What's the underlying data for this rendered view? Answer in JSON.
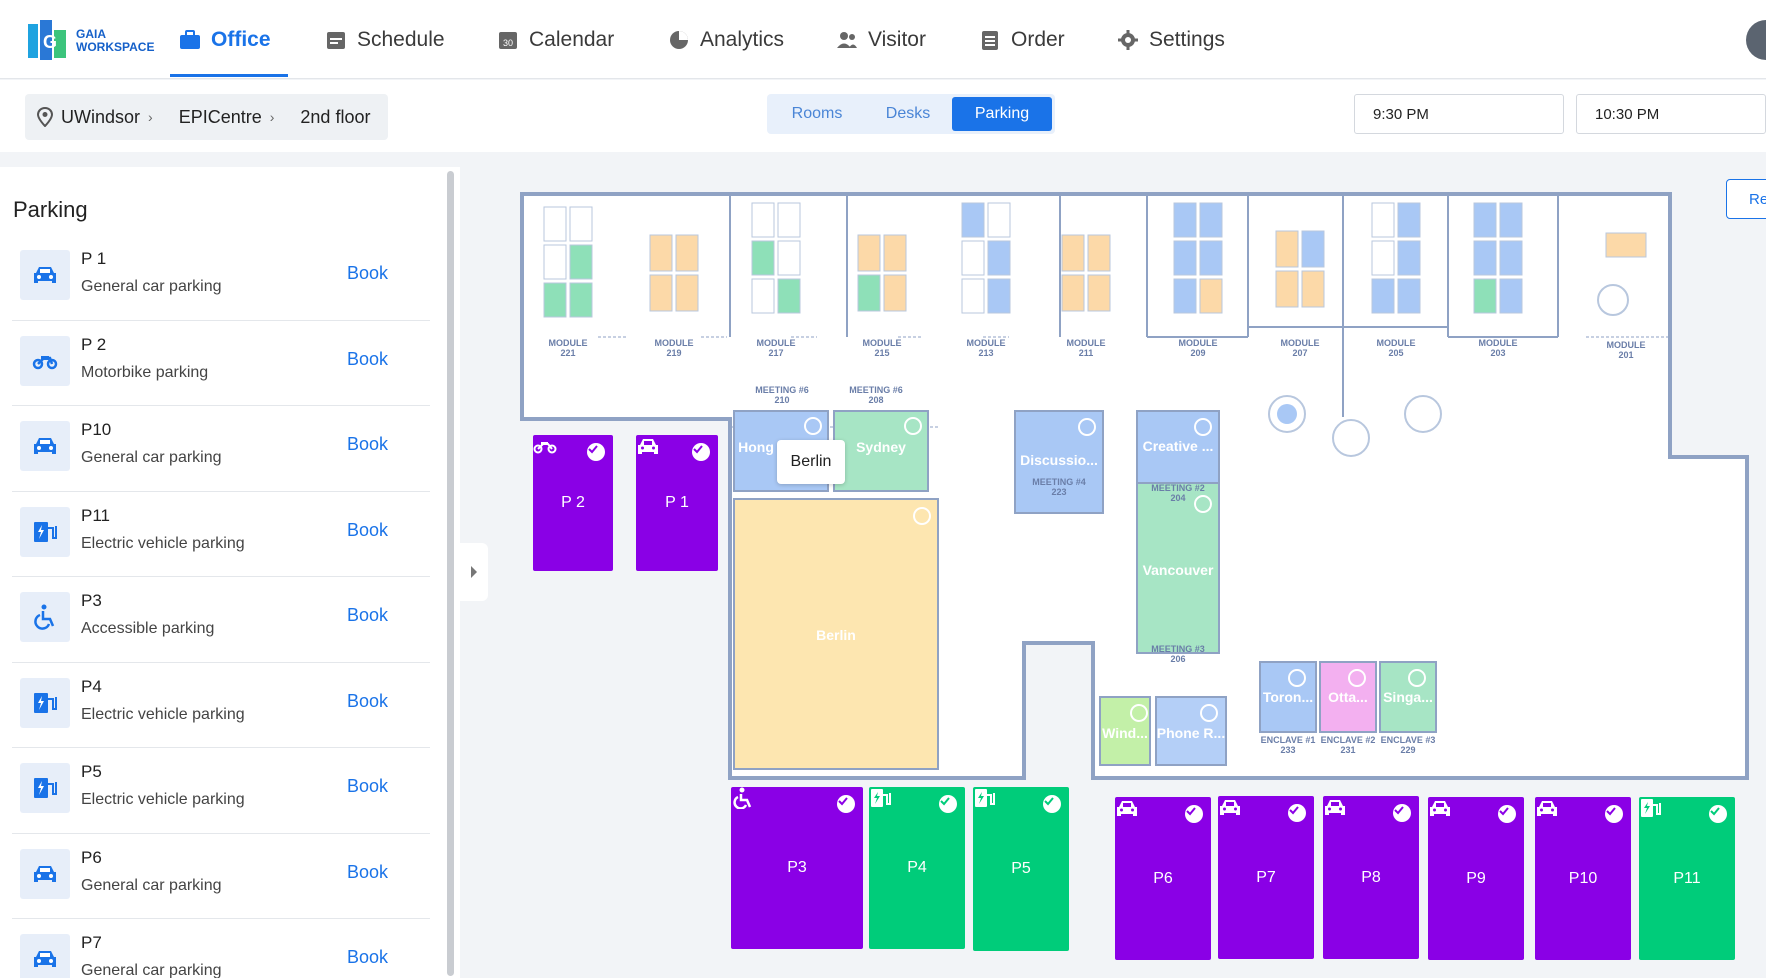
{
  "app": {
    "logo_line1": "GAIA",
    "logo_line2": "WORKSPACE"
  },
  "nav": [
    {
      "label": "Office",
      "icon": "briefcase-icon",
      "active": true
    },
    {
      "label": "Schedule",
      "icon": "schedule-icon"
    },
    {
      "label": "Calendar",
      "icon": "calendar-icon"
    },
    {
      "label": "Analytics",
      "icon": "pie-chart-icon"
    },
    {
      "label": "Visitor",
      "icon": "visitors-icon"
    },
    {
      "label": "Order",
      "icon": "clipboard-icon"
    },
    {
      "label": "Settings",
      "icon": "gear-icon"
    }
  ],
  "breadcrumb": {
    "campus": "UWindsor",
    "building": "EPICentre",
    "floor": "2nd floor"
  },
  "mode_tabs": [
    {
      "label": "Rooms"
    },
    {
      "label": "Desks"
    },
    {
      "label": "Parking",
      "active": true
    }
  ],
  "time": {
    "start": "9:30 PM",
    "end": "10:30 PM"
  },
  "sidebar": {
    "title": "Parking",
    "book_label": "Book",
    "items": [
      {
        "name": "P 1",
        "desc": "General car parking",
        "icon": "car-icon"
      },
      {
        "name": "P 2",
        "desc": "Motorbike parking",
        "icon": "motorbike-icon"
      },
      {
        "name": "P10",
        "desc": "General car parking",
        "icon": "car-icon"
      },
      {
        "name": "P11",
        "desc": "Electric vehicle parking",
        "icon": "ev-charger-icon"
      },
      {
        "name": "P3",
        "desc": "Accessible parking",
        "icon": "wheelchair-icon"
      },
      {
        "name": "P4",
        "desc": "Electric vehicle parking",
        "icon": "ev-charger-icon"
      },
      {
        "name": "P5",
        "desc": "Electric vehicle parking",
        "icon": "ev-charger-icon"
      },
      {
        "name": "P6",
        "desc": "General car parking",
        "icon": "car-icon"
      },
      {
        "name": "P7",
        "desc": "General car parking",
        "icon": "car-icon"
      }
    ]
  },
  "map": {
    "re_button": "Re",
    "modules": [
      {
        "label": "MODULE",
        "num": "221"
      },
      {
        "label": "MODULE",
        "num": "219"
      },
      {
        "label": "MODULE",
        "num": "217"
      },
      {
        "label": "MODULE",
        "num": "215"
      },
      {
        "label": "MODULE",
        "num": "213"
      },
      {
        "label": "MODULE",
        "num": "211"
      },
      {
        "label": "MODULE",
        "num": "209"
      },
      {
        "label": "MODULE",
        "num": "207"
      },
      {
        "label": "MODULE",
        "num": "205"
      },
      {
        "label": "MODULE",
        "num": "203"
      },
      {
        "label": "MODULE",
        "num": "201"
      }
    ],
    "rooms": {
      "hong": "Hong",
      "sydney": "Sydney",
      "meeting210": "MEETING #6",
      "meeting210_num": "210",
      "meeting208": "MEETING #6",
      "meeting208_num": "208",
      "berlin": "Berlin",
      "discussion": "Discussio...",
      "meeting223": "MEETING #4",
      "meeting223_num": "223",
      "creative": "Creative ...",
      "meeting204": "MEETING #2",
      "meeting204_num": "204",
      "vancouver": "Vancouver",
      "meeting206": "MEETING #3",
      "meeting206_num": "206",
      "windsor": "Wind...",
      "phone": "Phone R...",
      "toronto": "Toron...",
      "ottawa": "Otta...",
      "singapore": "Singa...",
      "enclave1": "ENCLAVE #1",
      "enclave1_num": "233",
      "enclave2": "ENCLAVE #2",
      "enclave2_num": "231",
      "enclave3": "ENCLAVE #3",
      "enclave3_num": "229"
    },
    "tooltip": "Berlin",
    "parking": [
      {
        "label": "P 2",
        "type": "motorbike-icon",
        "color": "#8a00e6"
      },
      {
        "label": "P 1",
        "type": "car-icon",
        "color": "#8a00e6"
      },
      {
        "label": "P3",
        "type": "wheelchair-icon",
        "color": "#8a00e6"
      },
      {
        "label": "P4",
        "type": "ev-charger-icon",
        "color": "#00cc7a"
      },
      {
        "label": "P5",
        "type": "ev-charger-icon",
        "color": "#00cc7a"
      },
      {
        "label": "P6",
        "type": "car-icon",
        "color": "#8a00e6"
      },
      {
        "label": "P7",
        "type": "car-icon",
        "color": "#8a00e6"
      },
      {
        "label": "P8",
        "type": "car-icon",
        "color": "#8a00e6"
      },
      {
        "label": "P9",
        "type": "car-icon",
        "color": "#8a00e6"
      },
      {
        "label": "P10",
        "type": "car-icon",
        "color": "#8a00e6"
      },
      {
        "label": "P11",
        "type": "ev-charger-icon",
        "color": "#00cc7a"
      }
    ]
  },
  "colors": {
    "accent": "#1a73e8",
    "purple": "#8a00e6",
    "green": "#00cc7a"
  }
}
